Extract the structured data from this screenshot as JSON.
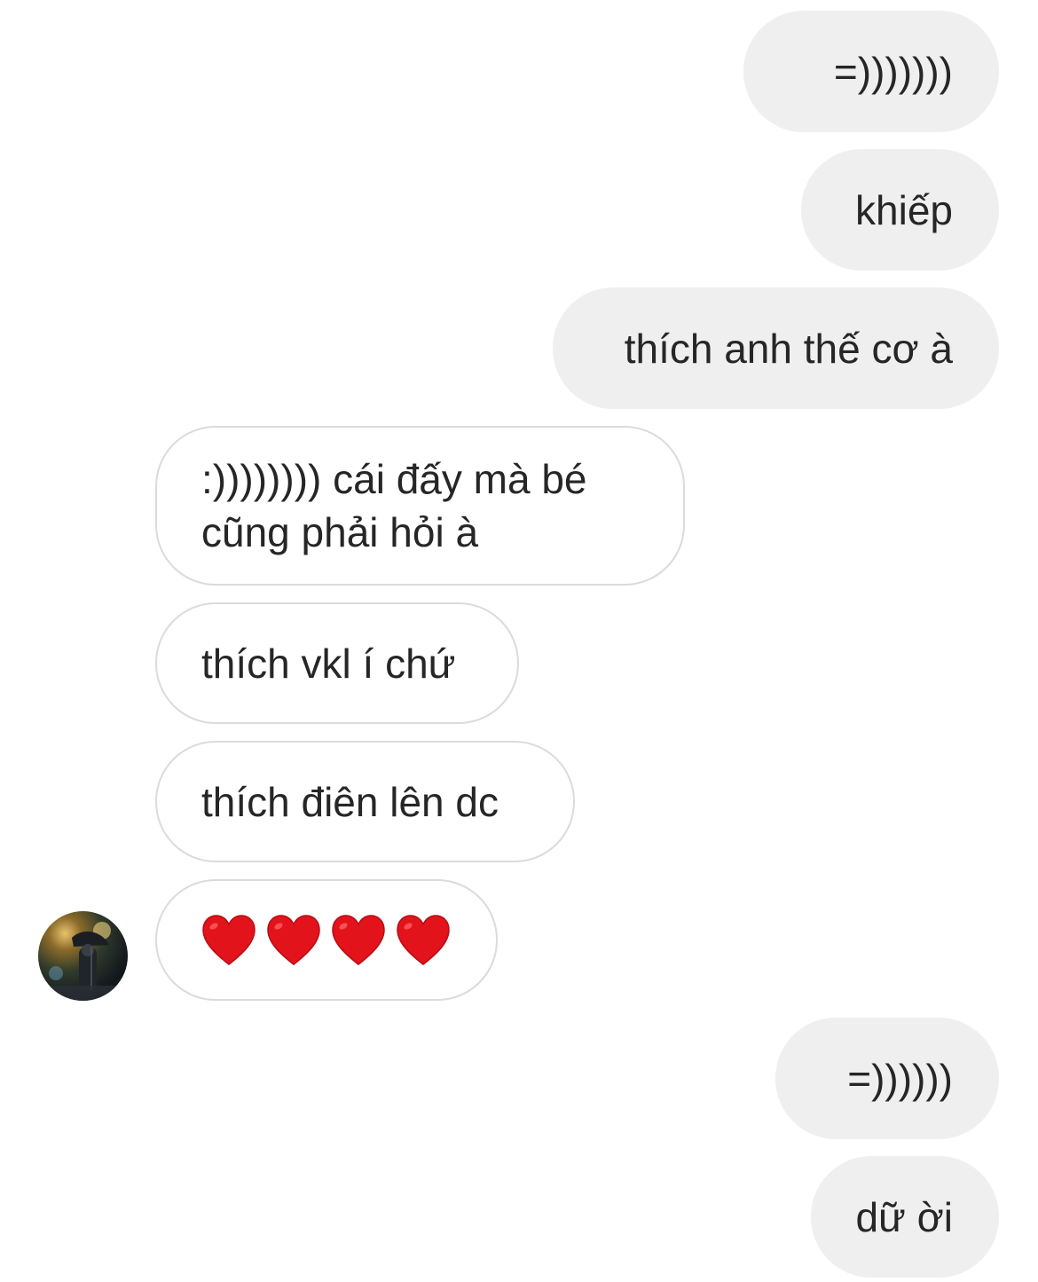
{
  "messages": [
    {
      "sender": "me",
      "text": "=)))))))"
    },
    {
      "sender": "me",
      "text": "khiếp"
    },
    {
      "sender": "me",
      "text": "thích anh thế cơ à"
    },
    {
      "sender": "other",
      "text": ":)))))))) cái đấy mà bé cũng phải hỏi à"
    },
    {
      "sender": "other",
      "text": "thích vkl í chứ"
    },
    {
      "sender": "other",
      "text": "thích điên lên dc"
    },
    {
      "sender": "other",
      "reaction_icons": [
        "red-heart-icon",
        "red-heart-icon",
        "red-heart-icon",
        "red-heart-icon"
      ]
    },
    {
      "sender": "me",
      "text": "=))))))"
    },
    {
      "sender": "me",
      "text": "dữ ời"
    }
  ],
  "colors": {
    "outgoing_bubble": "#efefef",
    "incoming_border": "#dbdbdb",
    "text": "#262626",
    "heart": "#e3131b"
  }
}
